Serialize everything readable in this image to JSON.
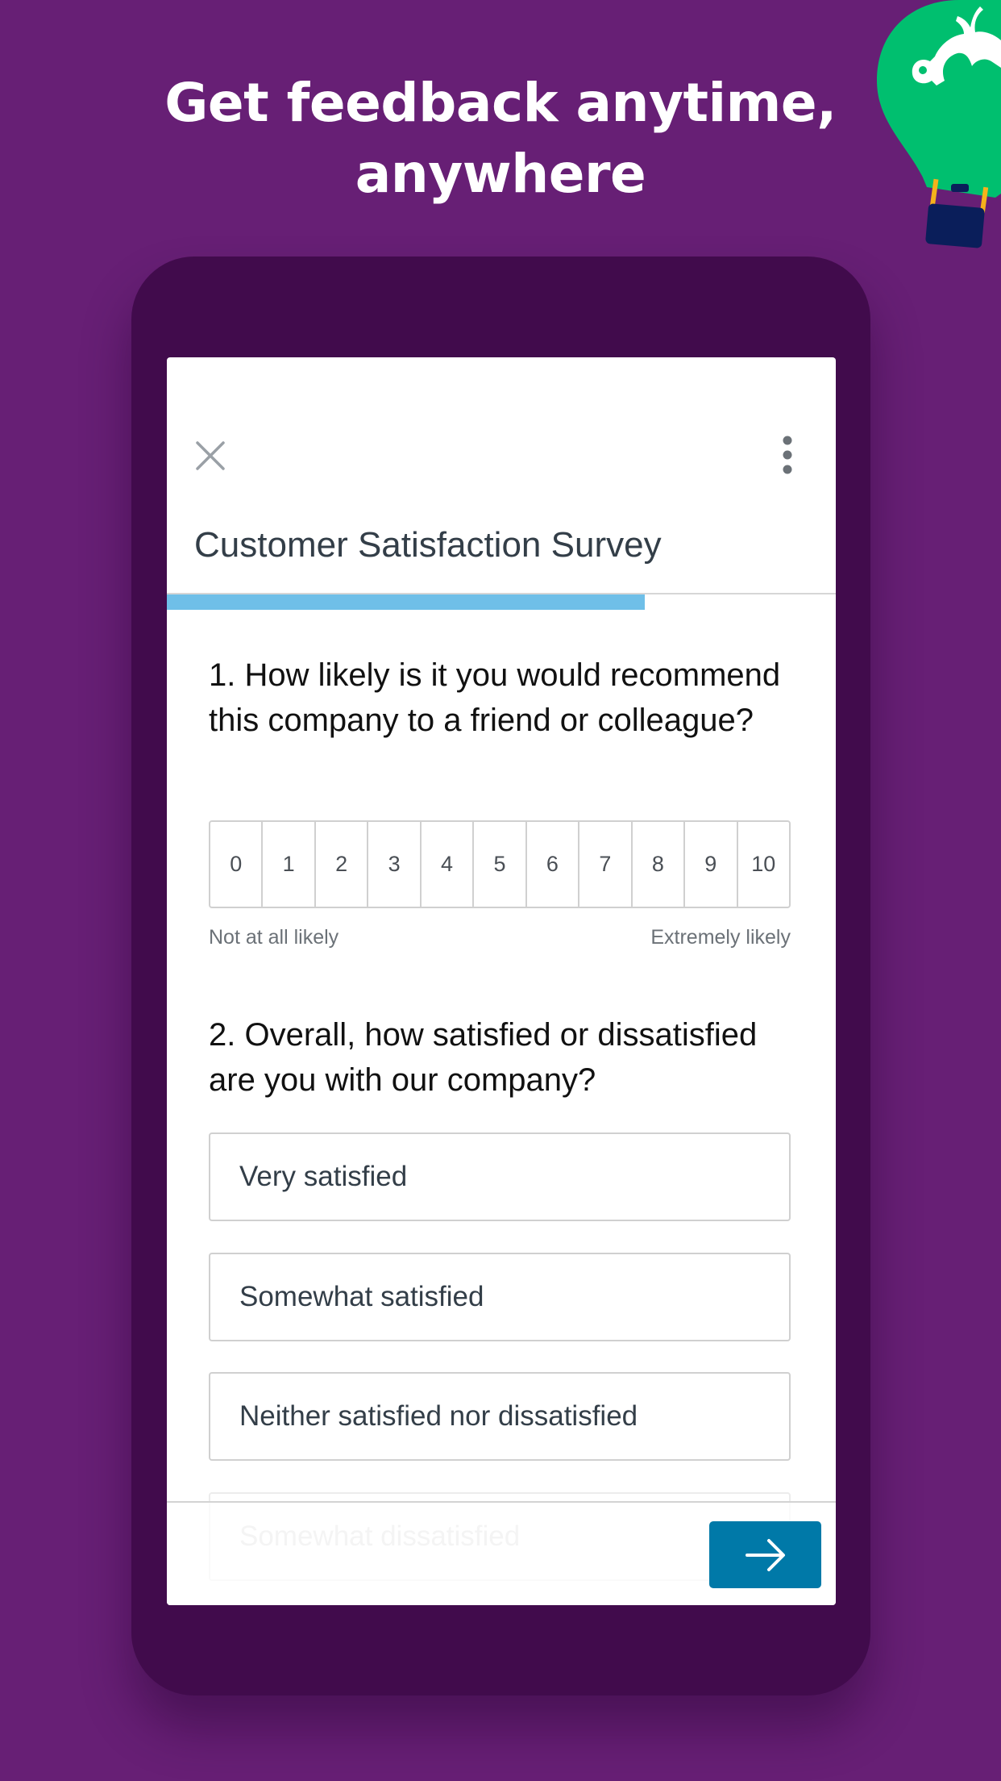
{
  "headline": {
    "line1": "Get feedback anytime,",
    "line2": "anywhere"
  },
  "colors": {
    "background": "#671f75",
    "phone_body": "#410b4c",
    "balloon_green": "#00bf6f",
    "progress": "#6fbfe8",
    "next_button": "#0079a8"
  },
  "survey": {
    "close_icon": "close-icon",
    "menu_icon": "more-vertical-icon",
    "title": "Customer Satisfaction Survey",
    "progress_fraction": 0.715,
    "questions": [
      {
        "text": "1. How likely is it you would recommend this company to a friend or colleague?",
        "type": "nps",
        "scale": [
          "0",
          "1",
          "2",
          "3",
          "4",
          "5",
          "6",
          "7",
          "8",
          "9",
          "10"
        ],
        "low_label": "Not at all likely",
        "high_label": "Extremely likely"
      },
      {
        "text": "2. Overall, how satisfied or dissatisfied are you with our company?",
        "type": "multiple_choice",
        "options": [
          "Very satisfied",
          "Somewhat satisfied",
          "Neither satisfied nor dissatisfied",
          "Somewhat dissatisfied"
        ]
      }
    ],
    "next_button_icon": "arrow-right-icon"
  }
}
